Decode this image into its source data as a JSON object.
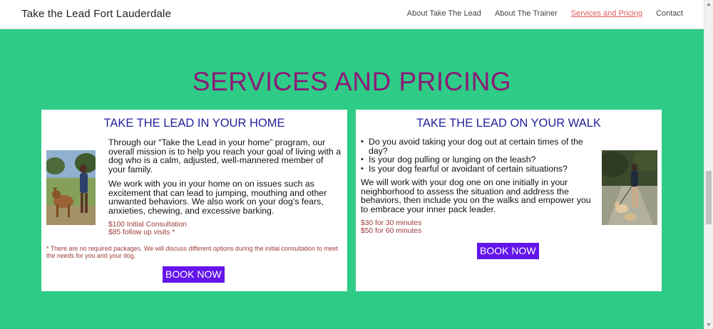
{
  "header": {
    "brand": "Take the Lead Fort Lauderdale",
    "nav": [
      "About Take The Lead",
      "About The Trainer",
      "Services and Pricing",
      "Contact"
    ],
    "active_nav": "Services and Pricing"
  },
  "page": {
    "title": "SERVICES AND PRICING"
  },
  "home_card": {
    "title": "TAKE THE LEAD IN YOUR HOME",
    "photo_alt": "child with dog in park",
    "paragraph1": "Through our “Take the Lead in your home” program, our overall mission is to help you reach your goal of living with a dog who is a calm, adjusted, well-mannered member of your family.",
    "paragraph2": "We work with you in your home on on issues such as excitement that can lead to jumping, mouthing and other unwanted behaviors. We also work on your dog’s fears, anxieties, chewing, and excessive barking.",
    "price1": "$100 Initial Consultation",
    "price2": "$85 follow up visits *",
    "note": "* There are no required packages. We will discuss different options during the initial consultation to meet the needs for you and your dog.",
    "button": "BOOK NOW"
  },
  "walk_card": {
    "title": "TAKE THE LEAD ON YOUR WALK",
    "photo_alt": "woman walking two dogs",
    "bullets": [
      "Do you avoid taking your dog out at certain times of the day?",
      "Is your dog pulling or lunging on the leash?",
      "Is your dog fearful or avoidant of certain situations?"
    ],
    "paragraph": "We will work with your dog one on one initially in your neighborhood to assess the situation and address the behaviors, then include you on the walks and empower you to embrace your inner pack leader.",
    "price1": "$30 for 30 minutes",
    "price2": "$50 for 60 minutes",
    "button": "BOOK NOW"
  },
  "colors": {
    "background": "#2ecc86",
    "title": "#8c1a78",
    "card_title": "#1f1f9e",
    "price": "#9e3a3a",
    "button": "#6415ec",
    "active_nav": "#e0595c"
  }
}
